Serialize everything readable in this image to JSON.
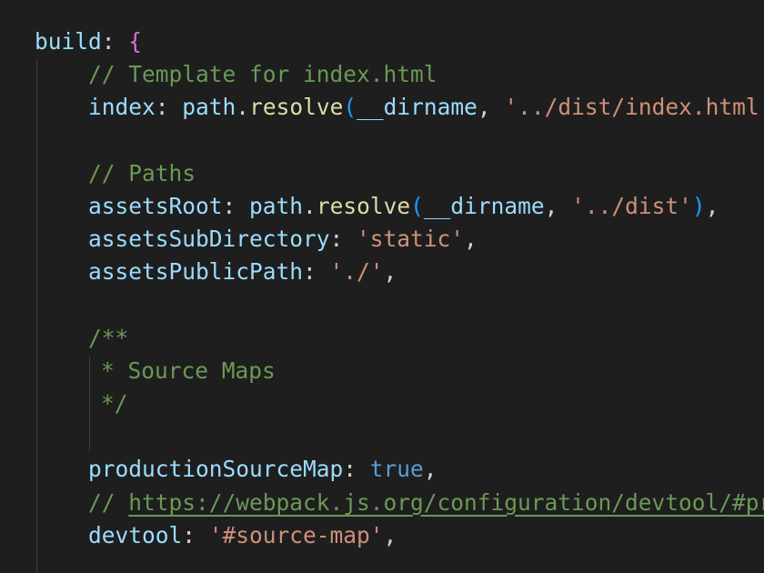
{
  "editor": {
    "lines": [
      [
        {
          "t": "build",
          "c": "prop"
        },
        {
          "t": ": ",
          "c": "pun"
        },
        {
          "t": "{",
          "c": "brace"
        }
      ],
      [
        {
          "t": "// Template for index.html",
          "c": "cmt"
        }
      ],
      [
        {
          "t": "index",
          "c": "prop"
        },
        {
          "t": ": ",
          "c": "pun"
        },
        {
          "t": "path",
          "c": "prop"
        },
        {
          "t": ".",
          "c": "pun"
        },
        {
          "t": "resolve",
          "c": "func"
        },
        {
          "t": "(",
          "c": "paren"
        },
        {
          "t": "__dirname",
          "c": "prop"
        },
        {
          "t": ", ",
          "c": "pun"
        },
        {
          "t": "'../dist/index.html'",
          "c": "str"
        }
      ],
      [],
      [
        {
          "t": "// Paths",
          "c": "cmt"
        }
      ],
      [
        {
          "t": "assetsRoot",
          "c": "prop"
        },
        {
          "t": ": ",
          "c": "pun"
        },
        {
          "t": "path",
          "c": "prop"
        },
        {
          "t": ".",
          "c": "pun"
        },
        {
          "t": "resolve",
          "c": "func"
        },
        {
          "t": "(",
          "c": "paren"
        },
        {
          "t": "__dirname",
          "c": "prop"
        },
        {
          "t": ", ",
          "c": "pun"
        },
        {
          "t": "'../dist'",
          "c": "str"
        },
        {
          "t": ")",
          "c": "paren"
        },
        {
          "t": ",",
          "c": "pun"
        }
      ],
      [
        {
          "t": "assetsSubDirectory",
          "c": "prop"
        },
        {
          "t": ": ",
          "c": "pun"
        },
        {
          "t": "'static'",
          "c": "str"
        },
        {
          "t": ",",
          "c": "pun"
        }
      ],
      [
        {
          "t": "assetsPublicPath",
          "c": "prop"
        },
        {
          "t": ": ",
          "c": "pun"
        },
        {
          "t": "'./'",
          "c": "str"
        },
        {
          "t": ",",
          "c": "pun"
        }
      ],
      [],
      [
        {
          "t": "/**",
          "c": "cmt"
        }
      ],
      [
        {
          "t": "* Source Maps",
          "c": "cmt"
        }
      ],
      [
        {
          "t": "*/",
          "c": "cmt"
        }
      ],
      [],
      [
        {
          "t": "productionSourceMap",
          "c": "prop"
        },
        {
          "t": ": ",
          "c": "pun"
        },
        {
          "t": "true",
          "c": "kw"
        },
        {
          "t": ",",
          "c": "pun"
        }
      ],
      [
        {
          "t": "// ",
          "c": "cmt"
        },
        {
          "t": "https://webpack.js.org/configuration/devtool/#production",
          "c": "link"
        }
      ],
      [
        {
          "t": "devtool",
          "c": "prop"
        },
        {
          "t": ": ",
          "c": "pun"
        },
        {
          "t": "'#source-map'",
          "c": "str"
        },
        {
          "t": ",",
          "c": "pun"
        }
      ]
    ]
  },
  "colors": {
    "background": "#1e1e1e",
    "property": "#9cdcfe",
    "function": "#dcdcaa",
    "string": "#ce9178",
    "keyword": "#569cd6",
    "comment": "#6a9955",
    "brace": "#da70d6",
    "paren": "#179fff"
  }
}
